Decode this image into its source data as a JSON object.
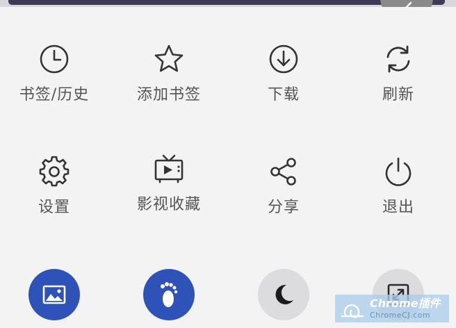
{
  "menu": {
    "row1": [
      {
        "label": "书签/历史",
        "icon": "clock-icon"
      },
      {
        "label": "添加书签",
        "icon": "star-icon"
      },
      {
        "label": "下载",
        "icon": "download-icon"
      },
      {
        "label": "刷新",
        "icon": "refresh-icon"
      }
    ],
    "row2": [
      {
        "label": "设置",
        "icon": "gear-icon"
      },
      {
        "label": "影视收藏",
        "icon": "tv-icon"
      },
      {
        "label": "分享",
        "icon": "share-icon"
      },
      {
        "label": "退出",
        "icon": "power-icon"
      }
    ],
    "toggles": [
      {
        "icon": "image-icon",
        "state": "on",
        "color": "#2f52b8"
      },
      {
        "icon": "footprint-icon",
        "state": "on",
        "color": "#2f52b8"
      },
      {
        "icon": "moon-icon",
        "state": "off",
        "color": "#dcdcde"
      },
      {
        "icon": "fullscreen-icon",
        "state": "off",
        "color": "#dcdcde"
      }
    ]
  },
  "watermark": {
    "top": "Chrome插件",
    "bottom": "ChromeCJ.com"
  },
  "colors": {
    "accent": "#2f52b8",
    "panel": "#f3f3f4",
    "icon": "#333333"
  }
}
